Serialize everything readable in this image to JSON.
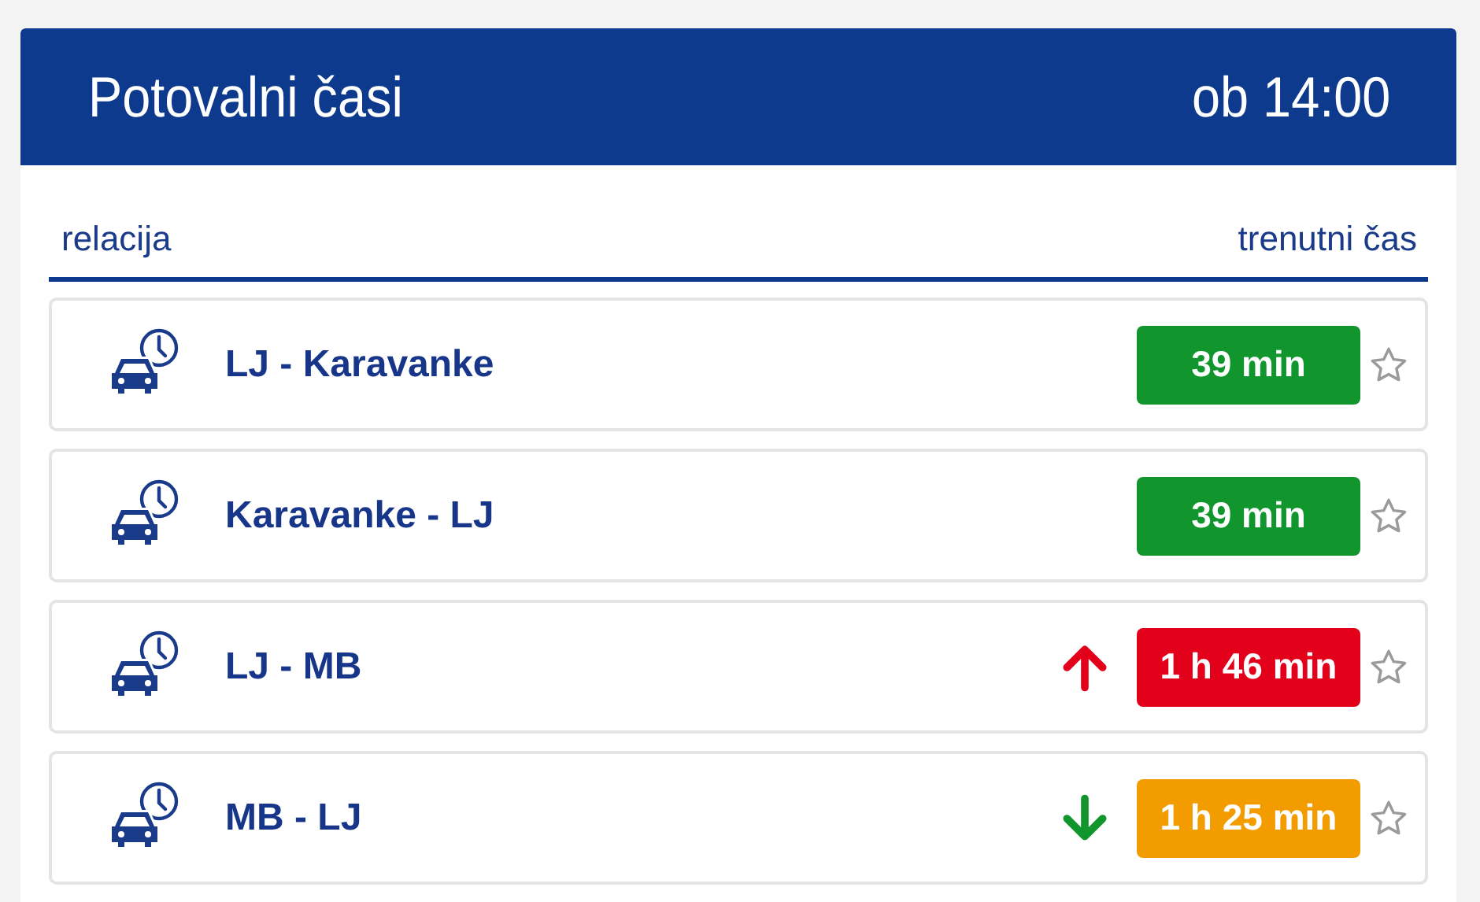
{
  "header": {
    "title": "Potovalni časi",
    "time": "ob 14:00"
  },
  "columns": [
    "relacija",
    "trenutni čas"
  ],
  "rows": [
    {
      "kind": "steady",
      "route": "LJ - Karavanke",
      "duration": "39 min",
      "color": "#11962d",
      "favorite": false
    },
    {
      "kind": "steady",
      "route": "Karavanke - LJ",
      "duration": "39 min",
      "color": "#11962d",
      "favorite": false
    },
    {
      "kind": "rising",
      "route": "LJ - MB",
      "duration": "1 h 46 min",
      "color": "#e2001a",
      "favorite": false
    },
    {
      "kind": "falling",
      "route": "MB - LJ",
      "duration": "1 h 25 min",
      "color": "#f39c00",
      "favorite": false
    }
  ]
}
